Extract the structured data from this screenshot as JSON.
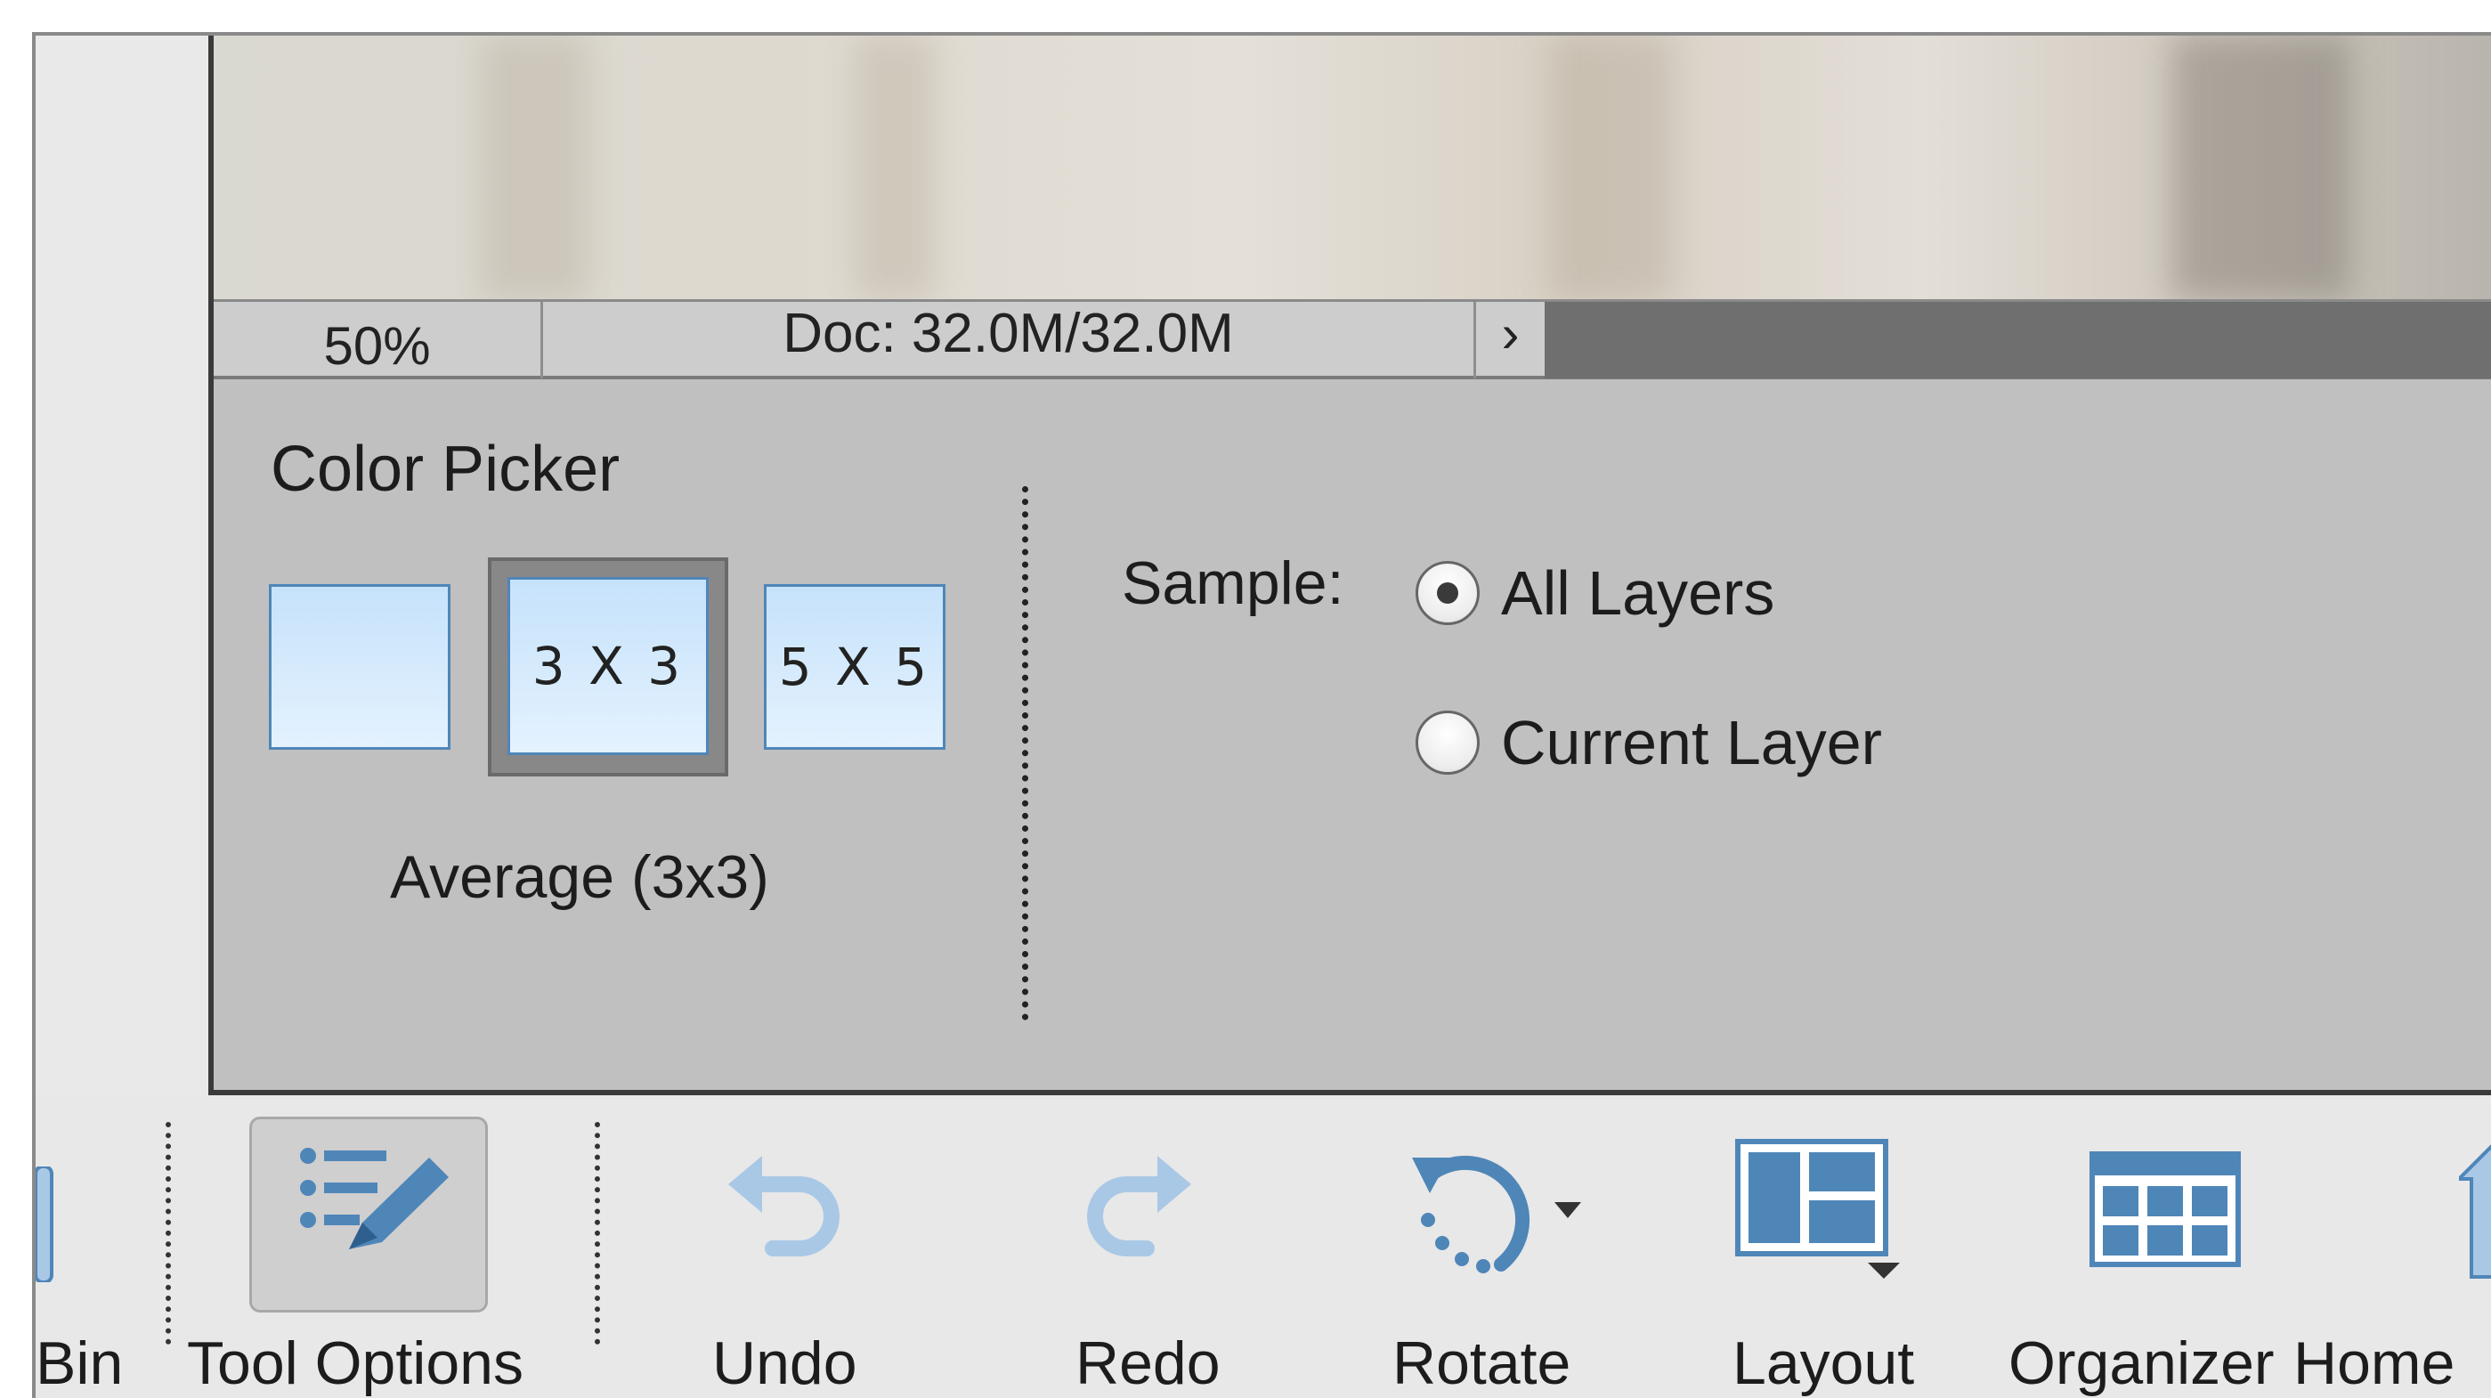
{
  "status_bar": {
    "zoom": "50%",
    "doc_size": "Doc: 32.0M/32.0M",
    "arrow": "›"
  },
  "tool_options": {
    "title": "Color Picker",
    "sample_sizes": [
      {
        "label": "",
        "selected": false
      },
      {
        "label": "3 X 3",
        "selected": true
      },
      {
        "label": "5 X 5",
        "selected": false
      }
    ],
    "current_size_label": "Average (3x3)",
    "sample_label": "Sample:",
    "sample_options": [
      {
        "label": "All Layers",
        "selected": true
      },
      {
        "label": "Current Layer",
        "selected": false
      }
    ]
  },
  "taskbar": {
    "items": [
      {
        "label": "Bin",
        "icon": "bin-icon"
      },
      {
        "label": "Tool Options",
        "icon": "tool-options-icon",
        "active": true
      },
      {
        "label": "Undo",
        "icon": "undo-icon"
      },
      {
        "label": "Redo",
        "icon": "redo-icon"
      },
      {
        "label": "Rotate",
        "icon": "rotate-icon"
      },
      {
        "label": "Layout",
        "icon": "layout-icon"
      },
      {
        "label": "Organizer",
        "icon": "organizer-icon"
      },
      {
        "label": "Home",
        "icon": "home-icon"
      }
    ]
  },
  "colors": {
    "panel_bg": "#c0c0c0",
    "taskbar_bg": "#e8e8e8",
    "icon_blue": "#4f86b8",
    "icon_light_blue": "#a9c8e6"
  }
}
